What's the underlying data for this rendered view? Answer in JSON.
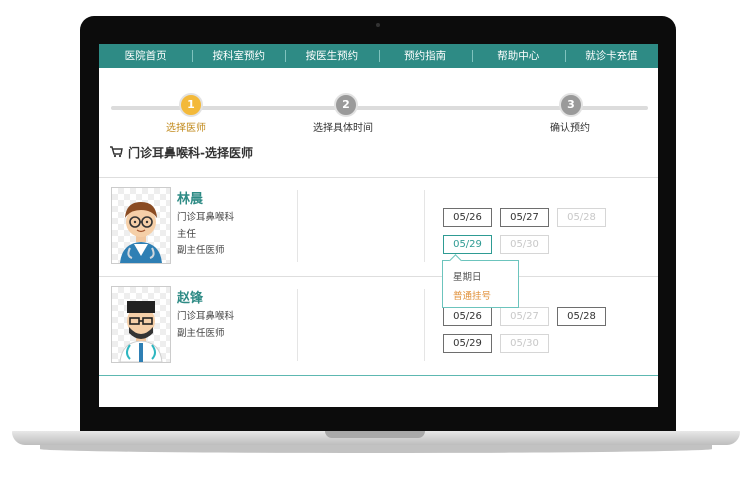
{
  "nav": {
    "items": [
      "医院首页",
      "按科室预约",
      "按医生预约",
      "预约指南",
      "帮助中心",
      "就诊卡充值"
    ]
  },
  "steps": [
    {
      "number": "1",
      "label": "选择医师",
      "state": "active",
      "color": "#f3b93a"
    },
    {
      "number": "2",
      "label": "选择具体时间",
      "state": "inactive",
      "color": "#9a9a9a"
    },
    {
      "number": "3",
      "label": "确认预约",
      "state": "inactive",
      "color": "#9a9a9a"
    }
  ],
  "page_title": "门诊耳鼻喉科-选择医师",
  "doctors": [
    {
      "name": "林晨",
      "department": "门诊耳鼻喉科",
      "position": "主任",
      "title": "副主任医师",
      "dates": [
        {
          "label": "05/26",
          "state": "available"
        },
        {
          "label": "05/27",
          "state": "available"
        },
        {
          "label": "05/28",
          "state": "disabled"
        },
        {
          "label": "05/29",
          "state": "selected"
        },
        {
          "label": "05/30",
          "state": "disabled"
        }
      ]
    },
    {
      "name": "赵锋",
      "department": "门诊耳鼻喉科",
      "title": "副主任医师",
      "dates": [
        {
          "label": "05/26",
          "state": "available"
        },
        {
          "label": "05/27",
          "state": "disabled"
        },
        {
          "label": "05/28",
          "state": "available"
        },
        {
          "label": "05/29",
          "state": "available"
        },
        {
          "label": "05/30",
          "state": "disabled"
        }
      ]
    }
  ],
  "popup": {
    "day": "星期日",
    "type": "普通挂号"
  },
  "colors": {
    "primary": "#2e8b85",
    "accent": "#f3b93a",
    "highlight": "#e0913a"
  }
}
